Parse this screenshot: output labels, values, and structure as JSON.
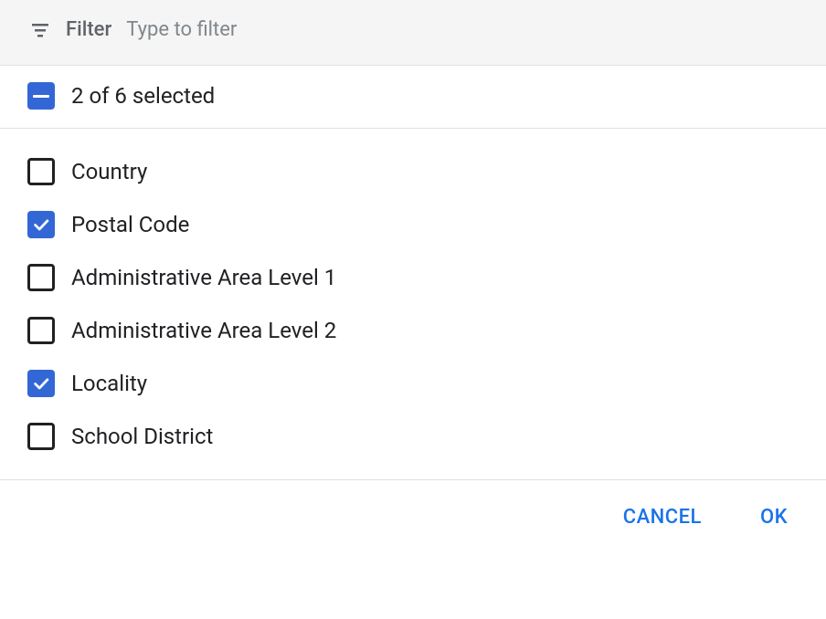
{
  "filter": {
    "label": "Filter",
    "placeholder": "Type to filter",
    "value": ""
  },
  "summary": {
    "text": "2 of 6 selected"
  },
  "options": [
    {
      "label": "Country",
      "checked": false
    },
    {
      "label": "Postal Code",
      "checked": true
    },
    {
      "label": "Administrative Area Level 1",
      "checked": false
    },
    {
      "label": "Administrative Area Level 2",
      "checked": false
    },
    {
      "label": "Locality",
      "checked": true
    },
    {
      "label": "School District",
      "checked": false
    }
  ],
  "actions": {
    "cancel": "CANCEL",
    "ok": "OK"
  },
  "colors": {
    "primary": "#3367d6",
    "link": "#1a73e8",
    "textPrimary": "#202124",
    "textSecondary": "#5f6368",
    "border": "#e0e0e0",
    "filterBg": "#f5f5f5"
  }
}
